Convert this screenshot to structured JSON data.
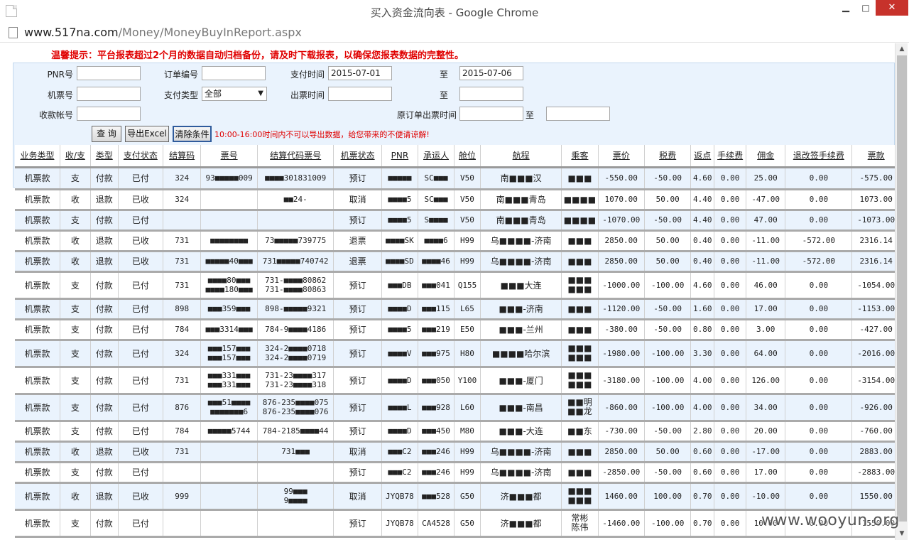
{
  "window": {
    "title": "买入资金流向表 - Google Chrome",
    "minimize": "▁",
    "maximize": "□",
    "close": "✕"
  },
  "address": {
    "host": "www.517na.com",
    "path": "/Money/MoneyBuyInReport.aspx"
  },
  "notice": "温馨提示：平台报表超过2个月的数据自动归档备份，请及时下载报表，以确保您报表数据的完整性。",
  "filters": {
    "pnr_label": "PNR号",
    "pnr_value": "",
    "order_label": "订单编号",
    "order_value": "",
    "paytime_label": "支付时间",
    "paytime_from": "2015-07-01",
    "to_label": "至",
    "paytime_to": "2015-07-06",
    "ticket_label": "机票号",
    "ticket_value": "",
    "paytype_label": "支付类型",
    "paytype_value": "全部",
    "issuetime_label": "出票时间",
    "issuetime_from": "",
    "issuetime_to": "",
    "account_label": "收款帐号",
    "account_value": "",
    "orig_issue_label": "原订单出票时间",
    "orig_issue_from": "",
    "orig_issue_to": "",
    "btn_query": "查 询",
    "btn_export": "导出Excel",
    "btn_clear": "清除条件",
    "warning": "10:00-16:00时间内不可以导出数据，给您带来的不便请谅解!"
  },
  "table": {
    "columns": [
      "业务类型",
      "收/支",
      "类型",
      "支付状态",
      "结算码",
      "票号",
      "结算代码票号",
      "机票状态",
      "PNR",
      "承运人",
      "舱位",
      "航程",
      "乘客",
      "票价",
      "税费",
      "返点",
      "手续费",
      "佣金",
      "退改签手续费",
      "票款"
    ],
    "rows": [
      {
        "biz": "机票款",
        "dir": "支",
        "type": "付款",
        "status": "已付",
        "code": "324",
        "ticket": "93■■■■■009",
        "settle": "■■■■301831009",
        "tstatus": "预订",
        "pnr": "■■■■■",
        "carrier": "SC■■■",
        "cabin": "V50",
        "route": "南■■■汉",
        "pax": "■■■",
        "price": "-550.00",
        "tax": "-50.00",
        "rebate": "4.60",
        "fee": "0.00",
        "comm": "25.00",
        "refund": "0.00",
        "total": "-575.00",
        "alt": true
      },
      {
        "biz": "机票款",
        "dir": "收",
        "type": "退款",
        "status": "已收",
        "code": "324",
        "ticket": "",
        "settle": "■■24-",
        "tstatus": "取消",
        "pnr": "■■■■5",
        "carrier": "SC■■■",
        "cabin": "V50",
        "route": "南■■■青岛",
        "pax": "■■■■",
        "price": "1070.00",
        "tax": "50.00",
        "rebate": "4.40",
        "fee": "0.00",
        "comm": "-47.00",
        "refund": "0.00",
        "total": "1073.00",
        "alt": false
      },
      {
        "biz": "机票款",
        "dir": "支",
        "type": "付款",
        "status": "已付",
        "code": "",
        "ticket": "",
        "settle": "",
        "tstatus": "预订",
        "pnr": "■■■■5",
        "carrier": "S■■■■",
        "cabin": "V50",
        "route": "南■■■青岛",
        "pax": "■■■■",
        "price": "-1070.00",
        "tax": "-50.00",
        "rebate": "4.40",
        "fee": "0.00",
        "comm": "47.00",
        "refund": "0.00",
        "total": "-1073.00",
        "alt": true
      },
      {
        "biz": "机票款",
        "dir": "收",
        "type": "退款",
        "status": "已收",
        "code": "731",
        "ticket": "■■■■■■■■",
        "settle": "73■■■■■739775",
        "tstatus": "退票",
        "pnr": "■■■■SK",
        "carrier": "■■■■6",
        "cabin": "H99",
        "route": "乌■■■■-济南",
        "pax": "■■■",
        "price": "2850.00",
        "tax": "50.00",
        "rebate": "0.40",
        "fee": "0.00",
        "comm": "-11.00",
        "refund": "-572.00",
        "total": "2316.14",
        "alt": false
      },
      {
        "biz": "机票款",
        "dir": "收",
        "type": "退款",
        "status": "已收",
        "code": "731",
        "ticket": "■■■■■40■■■",
        "settle": "731■■■■■740742",
        "tstatus": "退票",
        "pnr": "■■■■SD",
        "carrier": "■■■■46",
        "cabin": "H99",
        "route": "乌■■■■-济南",
        "pax": "■■■",
        "price": "2850.00",
        "tax": "50.00",
        "rebate": "0.40",
        "fee": "0.00",
        "comm": "-11.00",
        "refund": "-572.00",
        "total": "2316.14",
        "alt": true
      },
      {
        "biz": "机票款",
        "dir": "支",
        "type": "付款",
        "status": "已付",
        "code": "731",
        "ticket": "■■■■80■■■|■■■■180■■■",
        "settle": "731-■■■■80862|731-■■■■80863",
        "tstatus": "预订",
        "pnr": "■■■DB",
        "carrier": "■■■041",
        "cabin": "Q155",
        "route": "■■■大连",
        "pax": "■■■|■■■",
        "price": "-1000.00",
        "tax": "-100.00",
        "rebate": "4.60",
        "fee": "0.00",
        "comm": "46.00",
        "refund": "0.00",
        "total": "-1054.00",
        "alt": false
      },
      {
        "biz": "机票款",
        "dir": "支",
        "type": "付款",
        "status": "已付",
        "code": "898",
        "ticket": "■■■359■■■",
        "settle": "898-■■■■■9321",
        "tstatus": "预订",
        "pnr": "■■■■D",
        "carrier": "■■■115",
        "cabin": "L65",
        "route": "■■■-济南",
        "pax": "■■■",
        "price": "-1120.00",
        "tax": "-50.00",
        "rebate": "1.60",
        "fee": "0.00",
        "comm": "17.00",
        "refund": "0.00",
        "total": "-1153.00",
        "alt": true
      },
      {
        "biz": "机票款",
        "dir": "支",
        "type": "付款",
        "status": "已付",
        "code": "784",
        "ticket": "■■■3314■■■",
        "settle": "784-9■■■■4186",
        "tstatus": "预订",
        "pnr": "■■■■5",
        "carrier": "■■■219",
        "cabin": "E50",
        "route": "■■■-兰州",
        "pax": "■■■",
        "price": "-380.00",
        "tax": "-50.00",
        "rebate": "0.80",
        "fee": "0.00",
        "comm": "3.00",
        "refund": "0.00",
        "total": "-427.00",
        "alt": false
      },
      {
        "biz": "机票款",
        "dir": "支",
        "type": "付款",
        "status": "已付",
        "code": "324",
        "ticket": "■■■157■■■|■■■157■■■",
        "settle": "324-2■■■■0718|324-2■■■■0719",
        "tstatus": "预订",
        "pnr": "■■■■V",
        "carrier": "■■■975",
        "cabin": "H80",
        "route": "■■■■哈尔滨",
        "pax": "■■■|■■■",
        "price": "-1980.00",
        "tax": "-100.00",
        "rebate": "3.30",
        "fee": "0.00",
        "comm": "64.00",
        "refund": "0.00",
        "total": "-2016.00",
        "alt": true
      },
      {
        "biz": "机票款",
        "dir": "支",
        "type": "付款",
        "status": "已付",
        "code": "731",
        "ticket": "■■■331■■■|■■■331■■■",
        "settle": "731-23■■■■317|731-23■■■■318",
        "tstatus": "预订",
        "pnr": "■■■■D",
        "carrier": "■■■050",
        "cabin": "Y100",
        "route": "■■■-厦门",
        "pax": "■■■|■■■",
        "price": "-3180.00",
        "tax": "-100.00",
        "rebate": "4.00",
        "fee": "0.00",
        "comm": "126.00",
        "refund": "0.00",
        "total": "-3154.00",
        "alt": false
      },
      {
        "biz": "机票款",
        "dir": "支",
        "type": "付款",
        "status": "已付",
        "code": "876",
        "ticket": "■■■51■■■■|■■■■■■■6",
        "settle": "876-235■■■■075|876-235■■■■076",
        "tstatus": "预订",
        "pnr": "■■■■L",
        "carrier": "■■■928",
        "cabin": "L60",
        "route": "■■■-南昌",
        "pax": "■■明|■■龙",
        "price": "-860.00",
        "tax": "-100.00",
        "rebate": "4.00",
        "fee": "0.00",
        "comm": "34.00",
        "refund": "0.00",
        "total": "-926.00",
        "alt": true
      },
      {
        "biz": "机票款",
        "dir": "支",
        "type": "付款",
        "status": "已付",
        "code": "784",
        "ticket": "■■■■■5744",
        "settle": "784-2185■■■■44",
        "tstatus": "预订",
        "pnr": "■■■■D",
        "carrier": "■■■450",
        "cabin": "M80",
        "route": "■■■-大连",
        "pax": "■■东",
        "price": "-730.00",
        "tax": "-50.00",
        "rebate": "2.80",
        "fee": "0.00",
        "comm": "20.00",
        "refund": "0.00",
        "total": "-760.00",
        "alt": false
      },
      {
        "biz": "机票款",
        "dir": "收",
        "type": "退款",
        "status": "已收",
        "code": "731",
        "ticket": "",
        "settle": "731■■■",
        "tstatus": "取消",
        "pnr": "■■■C2",
        "carrier": "■■■246",
        "cabin": "H99",
        "route": "乌■■■■-济南",
        "pax": "■■■",
        "price": "2850.00",
        "tax": "50.00",
        "rebate": "0.60",
        "fee": "0.00",
        "comm": "-17.00",
        "refund": "0.00",
        "total": "2883.00",
        "alt": true
      },
      {
        "biz": "机票款",
        "dir": "支",
        "type": "付款",
        "status": "已付",
        "code": "",
        "ticket": "",
        "settle": "",
        "tstatus": "预订",
        "pnr": "■■■C2",
        "carrier": "■■■246",
        "cabin": "H99",
        "route": "乌■■■■-济南",
        "pax": "■■■",
        "price": "-2850.00",
        "tax": "-50.00",
        "rebate": "0.60",
        "fee": "0.00",
        "comm": "17.00",
        "refund": "0.00",
        "total": "-2883.00",
        "alt": false
      },
      {
        "biz": "机票款",
        "dir": "收",
        "type": "退款",
        "status": "已收",
        "code": "999",
        "ticket": "",
        "settle": "99■■■|9■■■■",
        "tstatus": "取消",
        "pnr": "JYQB78",
        "carrier": "■■■528",
        "cabin": "G50",
        "route": "济■■■都",
        "pax": "■■■|■■■",
        "price": "1460.00",
        "tax": "100.00",
        "rebate": "0.70",
        "fee": "0.00",
        "comm": "-10.00",
        "refund": "0.00",
        "total": "1550.00",
        "alt": true
      },
      {
        "biz": "机票款",
        "dir": "支",
        "type": "付款",
        "status": "已付",
        "code": "",
        "ticket": "",
        "settle": "",
        "tstatus": "预订",
        "pnr": "JYQB78",
        "carrier": "CA4528",
        "cabin": "G50",
        "route": "济■■■都",
        "pax": "常彬|陈伟",
        "price": "-1460.00",
        "tax": "-100.00",
        "rebate": "0.70",
        "fee": "0.00",
        "comm": "10.00",
        "refund": "0.00",
        "total": "-1550.00",
        "alt": false
      }
    ]
  },
  "scrollbar": {
    "up": "▲",
    "down": "▼"
  },
  "watermark": "www.wooyun.org"
}
